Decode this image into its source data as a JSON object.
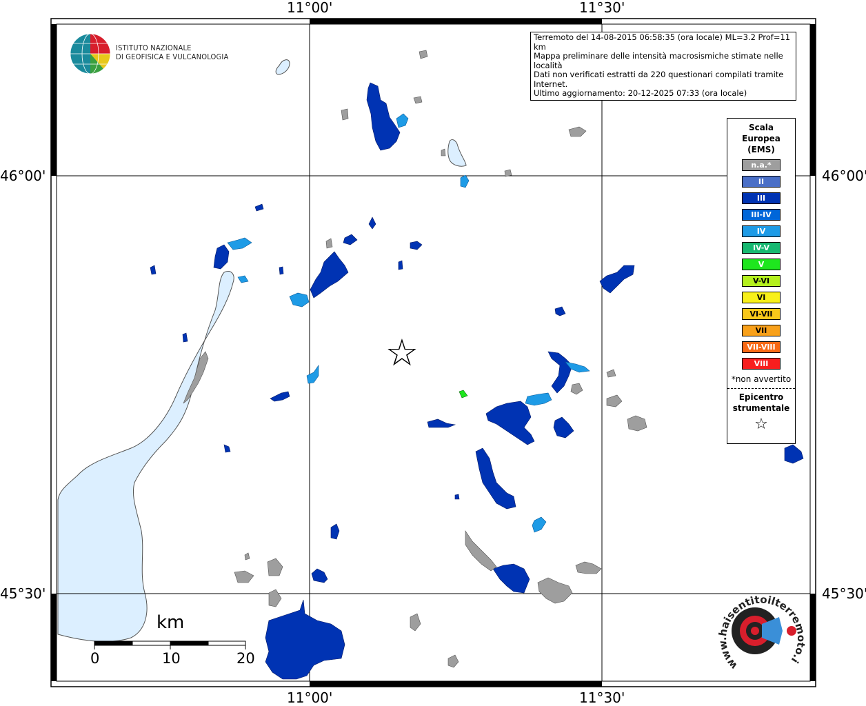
{
  "header": {
    "lon_labels_top": [
      "11°00'",
      "11°30'"
    ],
    "lon_labels_bottom": [
      "11°00'",
      "11°30'"
    ],
    "lat_labels_left": [
      "46°00'",
      "45°30'"
    ],
    "lat_labels_right": [
      "46°00'",
      "45°30'"
    ]
  },
  "logo": {
    "line1": "ISTITUTO NAZIONALE",
    "line2": "DI GEOFISICA E VULCANOLOGIA"
  },
  "info": {
    "line1": "Terremoto del 14-08-2015 06:58:35 (ora locale) ML=3.2 Prof=11 km",
    "line2": "Mappa preliminare delle intensità macrosismiche stimate nelle località",
    "line3": "Dati non verificati estratti da 220 questionari compilati tramite Internet.",
    "line4": "Ultimo aggiornamento: 20-12-2025 07:33 (ora locale)"
  },
  "legend": {
    "title_line1": "Scala",
    "title_line2": "Europea",
    "title_line3": "(EMS)",
    "classes": [
      {
        "label": "n.a.*",
        "color": "#9e9e9e"
      },
      {
        "label": "II",
        "color": "#4a6fc7"
      },
      {
        "label": "III",
        "color": "#0033b3"
      },
      {
        "label": "III-IV",
        "color": "#0066d9"
      },
      {
        "label": "IV",
        "color": "#1e9be6"
      },
      {
        "label": "IV-V",
        "color": "#16b870"
      },
      {
        "label": "V",
        "color": "#1ee61e"
      },
      {
        "label": "V-VI",
        "color": "#b4f01e"
      },
      {
        "label": "VI",
        "color": "#f8f01a"
      },
      {
        "label": "VI-VII",
        "color": "#f8c81a"
      },
      {
        "label": "VII",
        "color": "#f8a01a"
      },
      {
        "label": "VII-VIII",
        "color": "#f86814"
      },
      {
        "label": "VIII",
        "color": "#f81e1e"
      }
    ],
    "note": "*non avvertito",
    "epicenter_line1": "Epicentro",
    "epicenter_line2": "strumentale",
    "epicenter_symbol": "☆"
  },
  "scalebar": {
    "unit": "km",
    "ticks": [
      "0",
      "10",
      "20"
    ]
  },
  "colors": {
    "lake": "#dcefff",
    "intensity_III": "#0033b3",
    "intensity_IV": "#1e9be6",
    "not_felt": "#9e9e9e",
    "intensity_V": "#1ee61e"
  },
  "hsit_logo": {
    "text": "www.haisentitoilterremoto.it"
  }
}
